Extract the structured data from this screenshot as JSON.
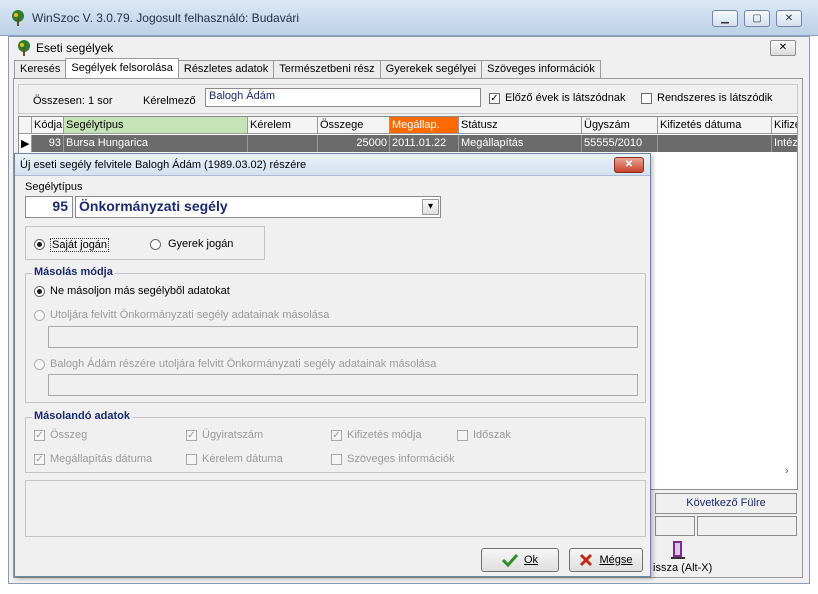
{
  "window": {
    "title": "WinSzoc V. 3.0.79. Jogosult felhasználó: Budavári",
    "btn_min": "▭",
    "btn_max": "▭",
    "btn_close": "✕"
  },
  "inner": {
    "title": "Eseti segélyek",
    "close": "✕"
  },
  "tabs": [
    "Keresés",
    "Segélyek felsorolása",
    "Részletes adatok",
    "Természetbeni rész",
    "Gyerekek segélyei",
    "Szöveges információk"
  ],
  "filter": {
    "total": "Összesen: 1 sor",
    "requester_label": "Kérelmező",
    "requester_value": "Balogh Ádám",
    "prev_years_label": "Előző évek is látszódnak",
    "prev_years_checked": true,
    "regular_label": "Rendszeres is látszódik",
    "regular_checked": false
  },
  "grid": {
    "columns": [
      "Kódja",
      "Segélytípus",
      "Kérelem",
      "Összege",
      "Megállap.",
      "Státusz",
      "Ügyszám",
      "Kifizetés dátuma",
      "Kifize"
    ],
    "rows": [
      [
        "93",
        "Bursa Hungarica",
        "",
        "25000",
        "2011.01.22",
        "Megállapítás",
        "55555/2010",
        "",
        "Intéz"
      ]
    ]
  },
  "right": {
    "next_button": "Következő Fülre",
    "back_button": "issza (Alt-X)",
    "scroll_arrow": "›"
  },
  "dialog": {
    "title": "Új eseti segély felvitele Balogh Ádám (1989.03.02) részére",
    "close": "✕",
    "type_label": "Segélytípus",
    "type_code": "95",
    "type_name": "Önkormányzati segély",
    "dropdown_arrow": "▾",
    "right_own": "Saját jogán",
    "right_child": "Gyerek jogán",
    "copy_mode": {
      "title": "Másolás módja",
      "opt1": "Ne másoljon más segélyből adatokat",
      "opt2": "Utoljára felvitt Önkormányzati segély adatainak másolása",
      "opt3": "Balogh Ádám részére utoljára felvitt Önkormányzati segély adatainak másolása"
    },
    "copy_data": {
      "title": "Másolandó adatok",
      "items": [
        {
          "label": "Összeg",
          "checked": true
        },
        {
          "label": "Ügyiratszám",
          "checked": true
        },
        {
          "label": "Kifizetés módja",
          "checked": true
        },
        {
          "label": "Időszak",
          "checked": false
        },
        {
          "label": "Megállapítás dátuma",
          "checked": true
        },
        {
          "label": "Kérelem dátuma",
          "checked": false
        },
        {
          "label": "Szöveges információk",
          "checked": false
        }
      ]
    },
    "ok": "Ok",
    "cancel": "Mégse"
  },
  "colors": {
    "accent_header": "#ff6a00",
    "selected_row": "#6b6b6b",
    "group_title": "#1a2a6c",
    "highlight_col": "#c6e3b8"
  }
}
